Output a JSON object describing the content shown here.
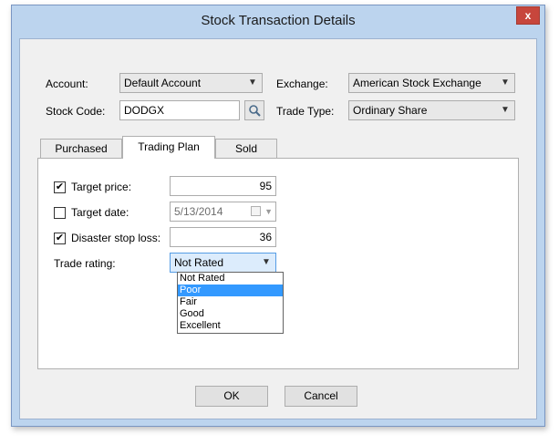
{
  "window": {
    "title": "Stock Transaction Details",
    "close_glyph": "x"
  },
  "fields": {
    "account_label": "Account:",
    "account_value": "Default Account",
    "exchange_label": "Exchange:",
    "exchange_value": "American Stock Exchange",
    "stock_code_label": "Stock Code:",
    "stock_code_value": "DODGX",
    "trade_type_label": "Trade Type:",
    "trade_type_value": "Ordinary Share"
  },
  "tabs": [
    {
      "label": "Purchased"
    },
    {
      "label": "Trading Plan"
    },
    {
      "label": "Sold"
    }
  ],
  "trading_plan": {
    "target_price_label": "Target price:",
    "target_price_checked": true,
    "target_price_value": "95",
    "target_date_label": "Target date:",
    "target_date_checked": false,
    "target_date_value": "5/13/2014",
    "stop_loss_label": "Disaster stop loss:",
    "stop_loss_checked": true,
    "stop_loss_value": "36",
    "rating_label": "Trade rating:",
    "rating_value": "Not Rated",
    "rating_options": [
      "Not Rated",
      "Poor",
      "Fair",
      "Good",
      "Excellent"
    ],
    "rating_highlighted": "Poor"
  },
  "buttons": {
    "ok": "OK",
    "cancel": "Cancel"
  },
  "icons": {
    "search": "search-icon",
    "dropdown": "chevron-down-icon",
    "check": "check-icon",
    "calendar": "calendar-icon"
  },
  "colors": {
    "window_frame": "#bcd4ee",
    "close_button": "#c7463c",
    "selection": "#3399ff"
  }
}
